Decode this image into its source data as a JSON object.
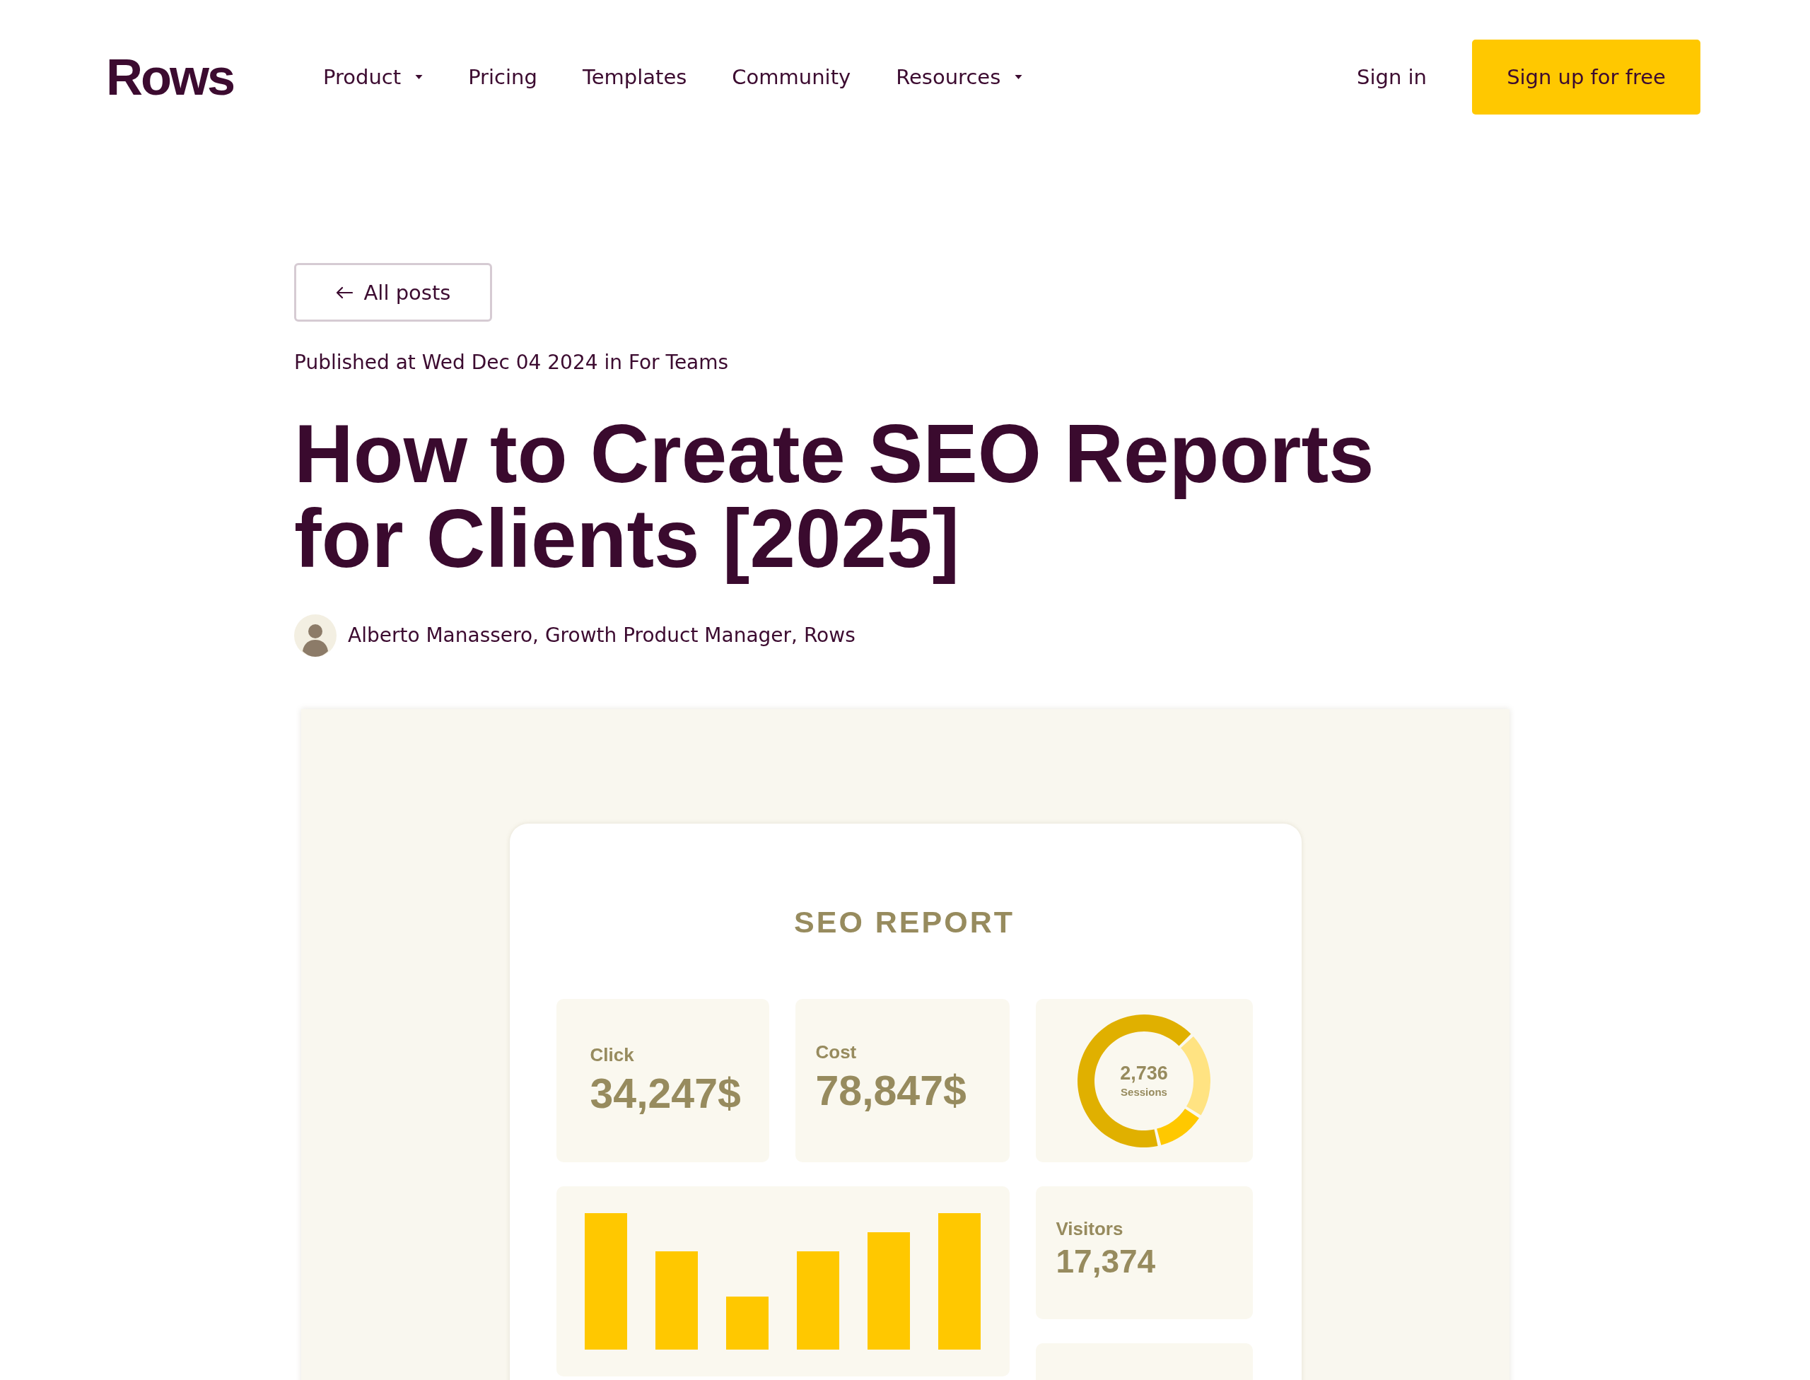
{
  "header": {
    "logo": "Rows",
    "nav": [
      {
        "label": "Product",
        "dropdown": true
      },
      {
        "label": "Pricing",
        "dropdown": false
      },
      {
        "label": "Templates",
        "dropdown": false
      },
      {
        "label": "Community",
        "dropdown": false
      },
      {
        "label": "Resources",
        "dropdown": true
      }
    ],
    "sign_in": "Sign in",
    "sign_up": "Sign up for free"
  },
  "article": {
    "back_link": "All posts",
    "published": "Published at Wed Dec 04 2024 in For Teams",
    "title": "How to Create SEO Reports for Clients [2025]",
    "author": "Alberto Manassero, Growth Product Manager, Rows"
  },
  "report_image": {
    "title": "SEO REPORT",
    "stats": [
      {
        "label": "Click",
        "value": "34,247$"
      },
      {
        "label": "Cost",
        "value": "78,847$"
      }
    ],
    "donut": {
      "value": "2,736",
      "label": "Sessions"
    },
    "visitors": {
      "label": "Visitors",
      "value": "17,374"
    }
  }
}
